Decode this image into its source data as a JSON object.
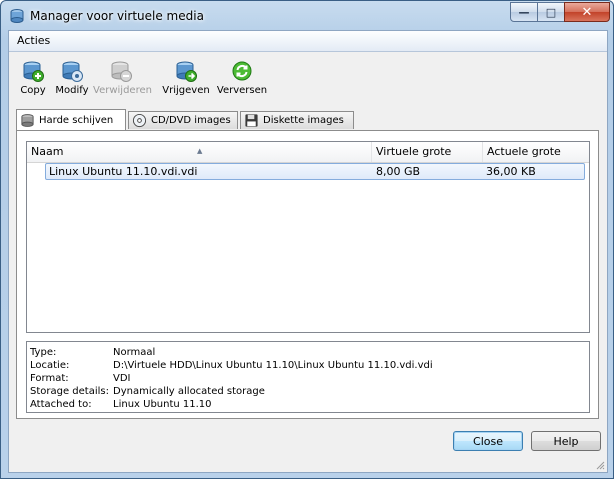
{
  "window": {
    "title": "Manager voor virtuele media"
  },
  "menu": {
    "acties": "Acties"
  },
  "toolbar": [
    {
      "label": "Copy",
      "icon": "copy-disk-icon",
      "enabled": true
    },
    {
      "label": "Modify",
      "icon": "modify-disk-icon",
      "enabled": true
    },
    {
      "label": "Verwijderen",
      "icon": "remove-disk-icon",
      "enabled": false
    },
    {
      "label": "Vrijgeven",
      "icon": "release-disk-icon",
      "enabled": true
    },
    {
      "label": "Verversen",
      "icon": "refresh-icon",
      "enabled": true
    }
  ],
  "tabs": [
    {
      "label": "Harde schijven",
      "icon": "hard-disk-icon",
      "active": true
    },
    {
      "label": "CD/DVD images",
      "icon": "cd-dvd-icon",
      "active": false
    },
    {
      "label": "Diskette images",
      "icon": "floppy-icon",
      "active": false
    }
  ],
  "table": {
    "columns": [
      "Naam",
      "Virtuele grote",
      "Actuele grote"
    ],
    "rows": [
      {
        "name": "Linux Ubuntu 11.10.vdi.vdi",
        "virtual": "8,00 GB",
        "actual": "36,00 KB",
        "selected": true
      }
    ]
  },
  "details": {
    "type_label": "Type:",
    "type_value": "Normaal",
    "location_label": "Locatie:",
    "location_value": "D:\\Virtuele HDD\\Linux Ubuntu 11.10\\Linux Ubuntu 11.10.vdi.vdi",
    "format_label": "Format:",
    "format_value": "VDI",
    "storage_label": "Storage details:",
    "storage_value": "Dynamically allocated storage",
    "attached_label": "Attached to:",
    "attached_value": "Linux Ubuntu 11.10"
  },
  "buttons": {
    "close": "Close",
    "help": "Help"
  },
  "colors": {
    "accent": "#3c7fb1",
    "selection": "#dfeafa",
    "titlebar": "#b9d1ea",
    "close_button": "#c24229"
  }
}
